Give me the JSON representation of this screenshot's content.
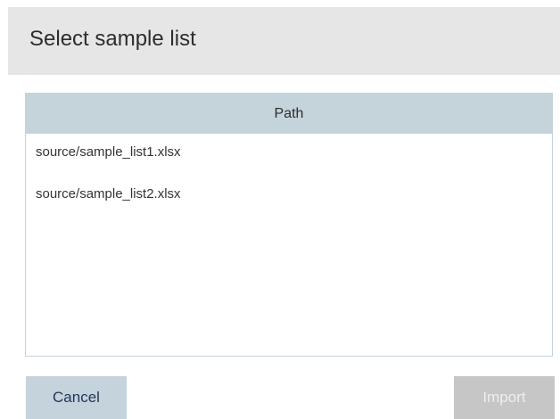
{
  "dialog": {
    "title": "Select sample list"
  },
  "table": {
    "columns": [
      "Path"
    ],
    "rows": [
      {
        "path": "source/sample_list1.xlsx"
      },
      {
        "path": "source/sample_list2.xlsx"
      }
    ]
  },
  "buttons": {
    "cancel_label": "Cancel",
    "import_label": "Import",
    "import_enabled": false
  },
  "colors": {
    "title_bar_bg": "#e6e6e6",
    "table_header_bg": "#c5d3db",
    "cancel_button_bg": "#c5d3dc",
    "disabled_button_bg": "#c6c6c6"
  }
}
